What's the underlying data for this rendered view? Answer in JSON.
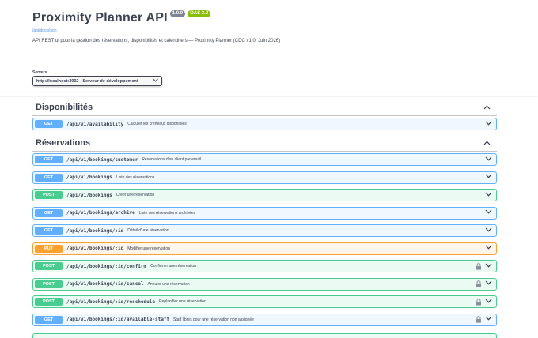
{
  "info": {
    "title": "Proximity Planner API",
    "version": "1.0.0",
    "oas": "OAS 3.0",
    "spec_link": "/api/docs/json",
    "description": "API RESTful pour la gestion des réservations, disponibilités et calendriers — Proximity Planner (CDC v1.0, Juin 2026)"
  },
  "servers": {
    "label": "Servers",
    "selected": "http://localhost:3002 - Serveur de développement"
  },
  "tags": [
    {
      "name": "Disponibilités",
      "operations": [
        {
          "method": "GET",
          "path": "/api/v1/availability",
          "summary": "Calculer les créneaux disponibles",
          "locked": false
        }
      ]
    },
    {
      "name": "Réservations",
      "operations": [
        {
          "method": "GET",
          "path": "/api/v1/bookings/customer",
          "summary": "Réservations d'un client par email",
          "locked": false
        },
        {
          "method": "GET",
          "path": "/api/v1/bookings",
          "summary": "Liste des réservations",
          "locked": false
        },
        {
          "method": "POST",
          "path": "/api/v1/bookings",
          "summary": "Créer une réservation",
          "locked": false
        },
        {
          "method": "GET",
          "path": "/api/v1/bookings/archive",
          "summary": "Liste des réservations archivées",
          "locked": false
        },
        {
          "method": "GET",
          "path": "/api/v1/bookings/:id",
          "summary": "Détail d'une réservation",
          "locked": false
        },
        {
          "method": "PUT",
          "path": "/api/v1/bookings/:id",
          "summary": "Modifier une réservation",
          "locked": false
        },
        {
          "method": "POST",
          "path": "/api/v1/bookings/:id/confirm",
          "summary": "Confirmer une réservation",
          "locked": true
        },
        {
          "method": "POST",
          "path": "/api/v1/bookings/:id/cancel",
          "summary": "Annuler une réservation",
          "locked": true
        },
        {
          "method": "POST",
          "path": "/api/v1/bookings/:id/reschedule",
          "summary": "Replanifier une réservation",
          "locked": true
        },
        {
          "method": "GET",
          "path": "/api/v1/bookings/:id/available-staff",
          "summary": "Staff libres pour une réservation non assignée",
          "locked": true
        }
      ]
    }
  ],
  "colors": {
    "get": "#61affe",
    "post": "#49cc90",
    "put": "#fca130",
    "text": "#3b4151",
    "link": "#4990e2"
  }
}
